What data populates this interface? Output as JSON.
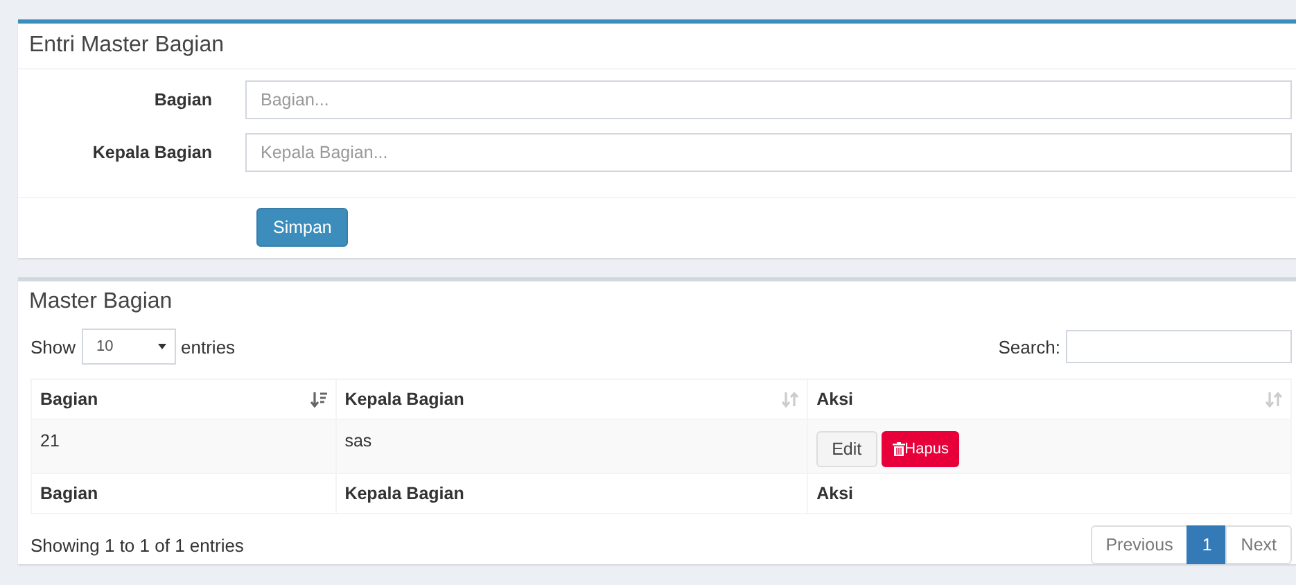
{
  "entry_box": {
    "title": "Entri Master Bagian",
    "fields": [
      {
        "label": "Bagian",
        "placeholder": "Bagian..."
      },
      {
        "label": "Kepala Bagian",
        "placeholder": "Kepala Bagian..."
      }
    ],
    "submit": "Simpan"
  },
  "table_box": {
    "title": "Master Bagian",
    "length": {
      "before": "Show",
      "value": "10",
      "after": "entries"
    },
    "search": {
      "label": "Search:"
    },
    "columns": [
      {
        "label": "Bagian",
        "sorted": true
      },
      {
        "label": "Kepala Bagian",
        "sorted": false
      },
      {
        "label": "Aksi",
        "sorted": false
      }
    ],
    "rows": [
      {
        "cells": [
          "21",
          "sas"
        ],
        "actions": [
          {
            "label": "Edit",
            "kind": "edit"
          },
          {
            "label": "Hapus",
            "kind": "delete"
          }
        ]
      }
    ],
    "footer": [
      "Bagian",
      "Kepala Bagian",
      "Aksi"
    ],
    "info": "Showing 1 to 1 of 1 entries",
    "pagination": [
      {
        "label": "Previous",
        "selected": false,
        "disabled": true
      },
      {
        "label": "1",
        "selected": true,
        "disabled": false
      },
      {
        "label": "Next",
        "selected": false,
        "disabled": true
      }
    ]
  }
}
